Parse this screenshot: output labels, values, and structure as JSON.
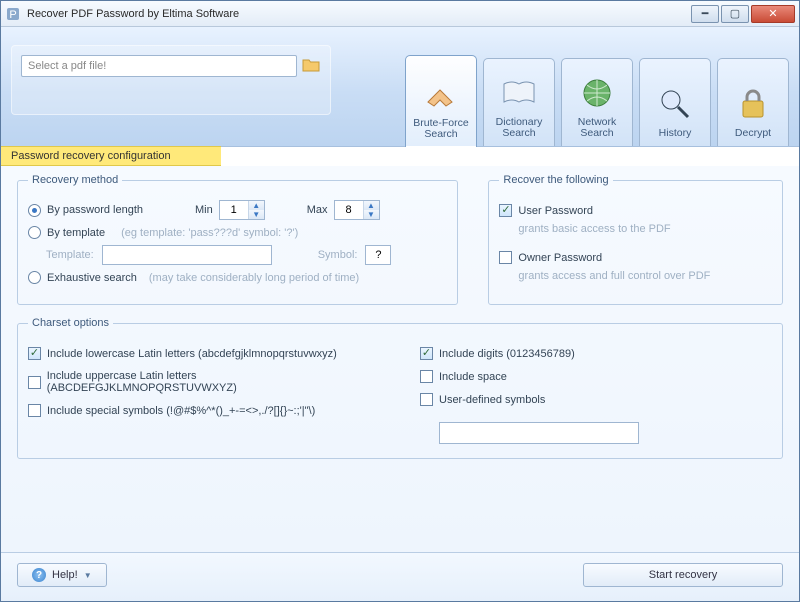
{
  "window": {
    "title": "Recover PDF Password by Eltima Software"
  },
  "file": {
    "placeholder": "Select a pdf file!"
  },
  "tabs": [
    {
      "id": "brute",
      "label": "Brute-Force Search",
      "active": true
    },
    {
      "id": "dict",
      "label": "Dictionary Search",
      "active": false
    },
    {
      "id": "network",
      "label": "Network Search",
      "active": false
    },
    {
      "id": "history",
      "label": "History",
      "active": false
    },
    {
      "id": "decrypt",
      "label": "Decrypt",
      "active": false
    }
  ],
  "strip": {
    "label": "Password recovery configuration"
  },
  "recovery": {
    "legend": "Recovery method",
    "by_length": {
      "label": "By password length",
      "checked": true
    },
    "min_label": "Min",
    "min_value": "1",
    "max_label": "Max",
    "max_value": "8",
    "by_template": {
      "label": "By template",
      "checked": false,
      "hint": "(eg template: 'pass???d' symbol: '?')"
    },
    "template_label": "Template:",
    "template_value": "",
    "symbol_label": "Symbol:",
    "symbol_value": "?",
    "exhaustive": {
      "label": "Exhaustive search",
      "checked": false,
      "hint": "(may take considerably long period of time)"
    }
  },
  "recover_target": {
    "legend": "Recover the following",
    "user_pw": {
      "label": "User Password",
      "checked": true,
      "sub": "grants basic access to the PDF"
    },
    "owner_pw": {
      "label": "Owner Password",
      "checked": false,
      "sub": "grants access and full control over PDF"
    }
  },
  "charset": {
    "legend": "Charset options",
    "lower": {
      "label": "Include lowercase Latin letters (abcdefgjklmnopqrstuvwxyz)",
      "checked": true
    },
    "upper": {
      "label": "Include uppercase Latin letters (ABCDEFGJKLMNOPQRSTUVWXYZ)",
      "checked": false
    },
    "special": {
      "label": "Include special symbols (!@#$%^*()_+-=<>,./?[]{}~:;'|\"\\)",
      "checked": false
    },
    "digits": {
      "label": "Include digits (0123456789)",
      "checked": true
    },
    "space": {
      "label": "Include space",
      "checked": false
    },
    "userdef": {
      "label": "User-defined symbols",
      "checked": false,
      "value": ""
    }
  },
  "footer": {
    "help": "Help!",
    "start": "Start recovery"
  }
}
